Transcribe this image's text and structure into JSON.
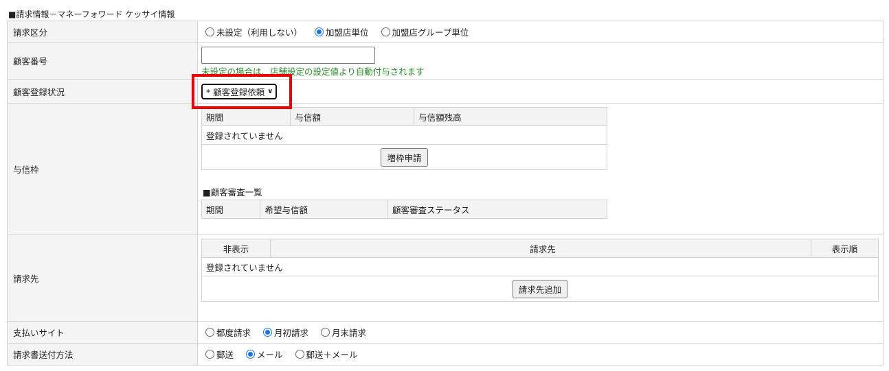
{
  "title": "■請求情報－マネーフォワード ケッサイ情報",
  "rows": {
    "billing_type": {
      "label": "請求区分",
      "options": [
        "未設定（利用しない）",
        "加盟店単位",
        "加盟店グループ単位"
      ],
      "selected": 1
    },
    "customer_no": {
      "label": "顧客番号",
      "value": "",
      "hint": "未設定の場合は、店舗設定の設定値より自動付与されます"
    },
    "customer_status": {
      "label": "顧客登録状況",
      "selected": "* 顧客登録依頼"
    },
    "credit": {
      "label": "与信枠",
      "headers": [
        "期間",
        "与信額",
        "与信額残高"
      ],
      "empty": "登録されていません",
      "button": "増枠申請",
      "review_title": "■顧客審査一覧",
      "review_headers": [
        "期間",
        "希望与信額",
        "顧客審査ステータス"
      ]
    },
    "billing_to": {
      "label": "請求先",
      "headers": [
        "非表示",
        "請求先",
        "表示順"
      ],
      "empty": "登録されていません",
      "button": "請求先追加"
    },
    "payment_site": {
      "label": "支払いサイト",
      "options": [
        "都度請求",
        "月初請求",
        "月末請求"
      ],
      "selected": 1
    },
    "invoice_method": {
      "label": "請求書送付方法",
      "options": [
        "郵送",
        "メール",
        "郵送＋メール"
      ],
      "selected": 1
    }
  }
}
